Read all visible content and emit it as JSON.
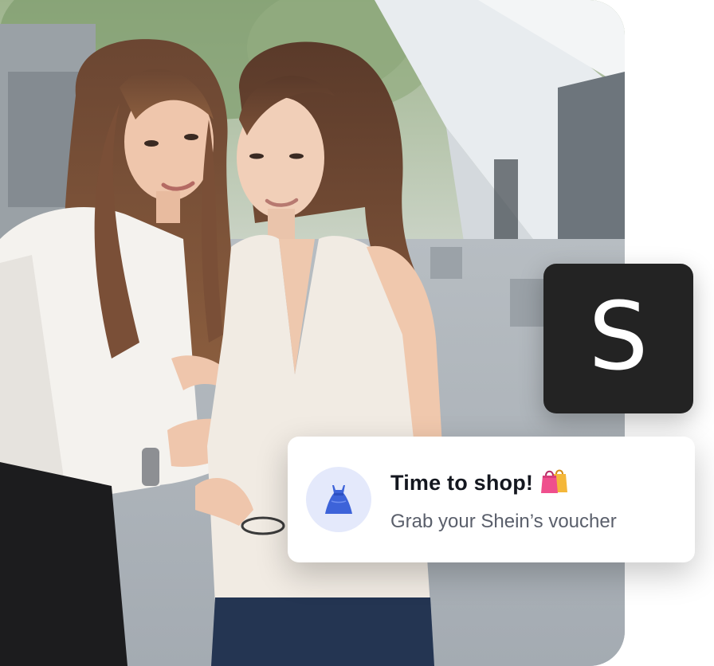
{
  "brand": {
    "logo_letter": "S",
    "logo_bg": "#232323",
    "logo_fg": "#ffffff"
  },
  "notification": {
    "title": "Time to shop!",
    "title_emoji_icon": "shopping-bags-icon",
    "subtitle": "Grab your Shein’s voucher",
    "icon": "dress-icon",
    "icon_color": "#3d63d9",
    "icon_bg": "#e4e9fb"
  },
  "photo": {
    "subject": "two-women-looking-at-phone"
  }
}
